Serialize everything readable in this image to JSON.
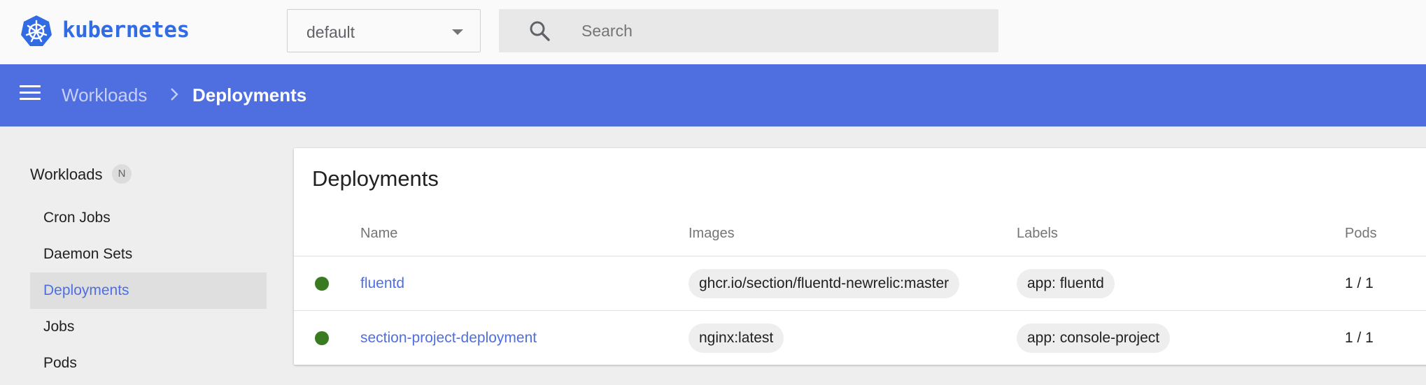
{
  "app": {
    "brand": "kubernetes"
  },
  "namespace": {
    "value": "default"
  },
  "search": {
    "placeholder": "Search"
  },
  "breadcrumb": {
    "parent": "Workloads",
    "current": "Deployments"
  },
  "sidebar": {
    "heading": "Workloads",
    "badge": "N",
    "items": [
      {
        "label": "Cron Jobs",
        "active": false
      },
      {
        "label": "Daemon Sets",
        "active": false
      },
      {
        "label": "Deployments",
        "active": true
      },
      {
        "label": "Jobs",
        "active": false
      },
      {
        "label": "Pods",
        "active": false
      }
    ]
  },
  "deployments": {
    "title": "Deployments",
    "columns": {
      "name": "Name",
      "images": "Images",
      "labels": "Labels",
      "pods": "Pods"
    },
    "rows": [
      {
        "status": "running",
        "name": "fluentd",
        "image": "ghcr.io/section/fluentd-newrelic:master",
        "label": "app: fluentd",
        "pods": "1 / 1"
      },
      {
        "status": "running",
        "name": "section-project-deployment",
        "image": "nginx:latest",
        "label": "app: console-project",
        "pods": "1 / 1"
      }
    ]
  },
  "colors": {
    "accent": "#4f6fe0",
    "brand": "#326ce5",
    "status_ok": "#3a7b22"
  }
}
